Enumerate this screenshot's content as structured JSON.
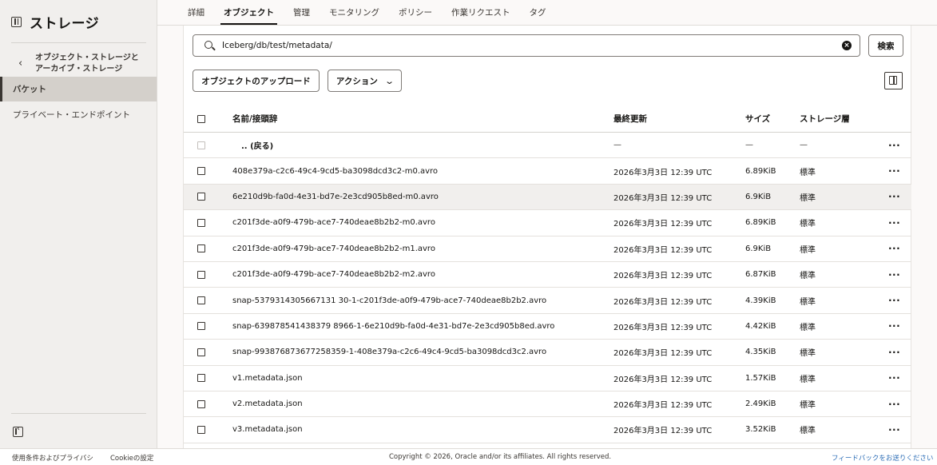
{
  "sidebar": {
    "title": "ストレージ",
    "back_label_line1": "オブジェクト・ストレージと",
    "back_label_line2": "アーカイブ・ストレージ",
    "items": [
      {
        "label": "バケット"
      },
      {
        "label": "プライベート・エンドポイント"
      }
    ]
  },
  "tabs": [
    {
      "label": "詳細"
    },
    {
      "label": "オブジェクト"
    },
    {
      "label": "管理"
    },
    {
      "label": "モニタリング"
    },
    {
      "label": "ポリシー"
    },
    {
      "label": "作業リクエスト"
    },
    {
      "label": "タグ"
    }
  ],
  "active_tab": "オブジェクト",
  "search": {
    "value": "Iceberg/db/test/metadata/",
    "button_label": "検索"
  },
  "toolbar": {
    "upload_label": "オブジェクトのアップロード",
    "action_label": "アクション"
  },
  "table": {
    "headers": {
      "name": "名前/接頭辞",
      "modified": "最終更新",
      "size": "サイズ",
      "tier": "ストレージ層"
    },
    "parent_row": {
      "name": ".. (戻る)",
      "modified": "—",
      "size": "—",
      "tier": "—"
    },
    "rows": [
      {
        "name": "408e379a-c2c6-49c4-9cd5-ba3098dcd3c2-m0.avro",
        "modified": "2026年3月3日 12:39 UTC",
        "size": "6.89KiB",
        "tier": "標準"
      },
      {
        "name": "6e210d9b-fa0d-4e31-bd7e-2e3cd905b8ed-m0.avro",
        "modified": "2026年3月3日 12:39 UTC",
        "size": "6.9KiB",
        "tier": "標準"
      },
      {
        "name": "c201f3de-a0f9-479b-ace7-740deae8b2b2-m0.avro",
        "modified": "2026年3月3日 12:39 UTC",
        "size": "6.89KiB",
        "tier": "標準"
      },
      {
        "name": "c201f3de-a0f9-479b-ace7-740deae8b2b2-m1.avro",
        "modified": "2026年3月3日 12:39 UTC",
        "size": "6.9KiB",
        "tier": "標準"
      },
      {
        "name": "c201f3de-a0f9-479b-ace7-740deae8b2b2-m2.avro",
        "modified": "2026年3月3日 12:39 UTC",
        "size": "6.87KiB",
        "tier": "標準"
      },
      {
        "name": "snap-5379314305667131 30-1-c201f3de-a0f9-479b-ace7-740deae8b2b2.avro",
        "modified": "2026年3月3日 12:39 UTC",
        "size": "4.39KiB",
        "tier": "標準"
      },
      {
        "name": "snap-639878541438379 8966-1-6e210d9b-fa0d-4e31-bd7e-2e3cd905b8ed.avro",
        "modified": "2026年3月3日 12:39 UTC",
        "size": "4.42KiB",
        "tier": "標準"
      },
      {
        "name": "snap-993876873677258359-1-408e379a-c2c6-49c4-9cd5-ba3098dcd3c2.avro",
        "modified": "2026年3月3日 12:39 UTC",
        "size": "4.35KiB",
        "tier": "標準"
      },
      {
        "name": "v1.metadata.json",
        "modified": "2026年3月3日 12:39 UTC",
        "size": "1.57KiB",
        "tier": "標準"
      },
      {
        "name": "v2.metadata.json",
        "modified": "2026年3月3日 12:39 UTC",
        "size": "2.49KiB",
        "tier": "標準"
      },
      {
        "name": "v3.metadata.json",
        "modified": "2026年3月3日 12:39 UTC",
        "size": "3.52KiB",
        "tier": "標準"
      }
    ],
    "row_menu_glyph": "···"
  },
  "footer": {
    "terms": "使用条件およびプライバシ",
    "cookie": "Cookieの設定",
    "copyright": "Copyright © 2026, Oracle and/or its affiliates. All rights reserved.",
    "feedback": "フィードバックをお送りください"
  }
}
